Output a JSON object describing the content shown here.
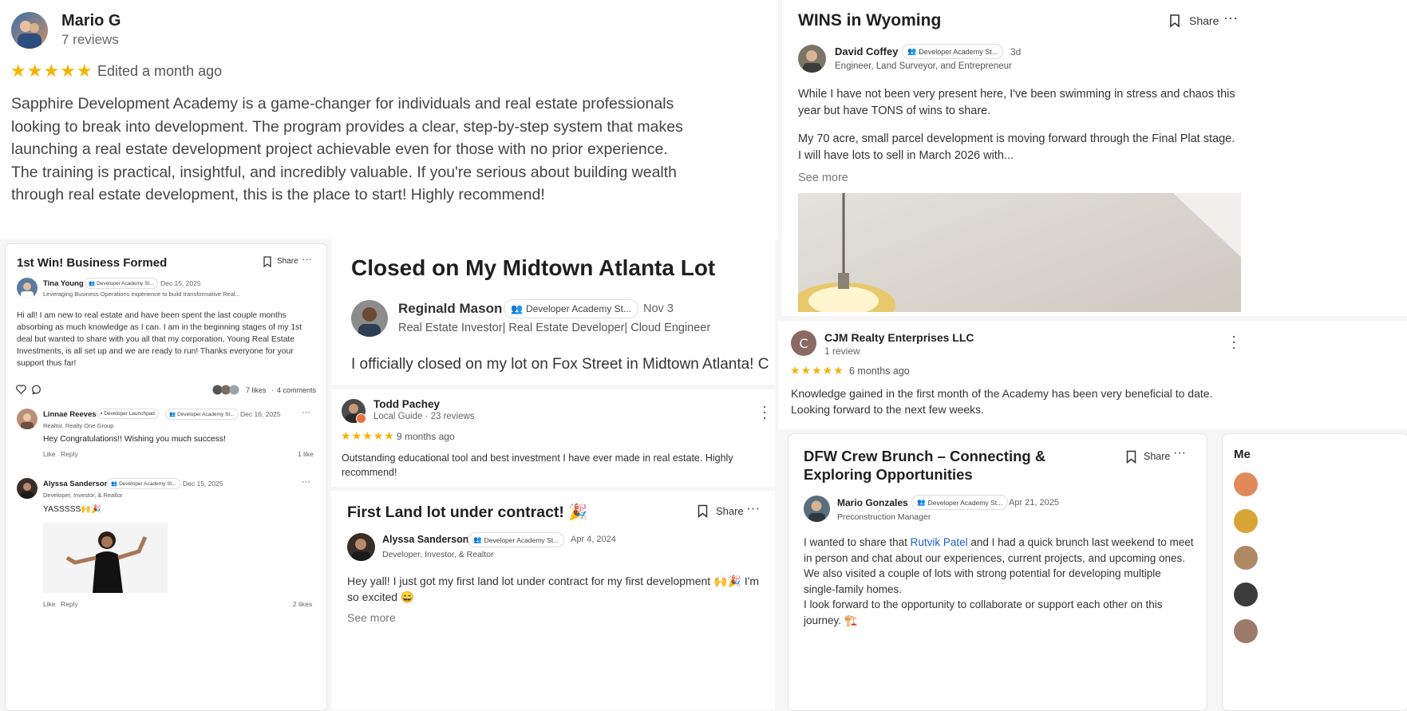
{
  "review_mario": {
    "name": "Mario G",
    "reviews": "7 reviews",
    "stars": "★★★★★",
    "edited": "Edited a month ago",
    "text": "Sapphire Development Academy is a game-changer for individuals and real estate professionals looking to break into development. The program provides a clear, step-by-step system that makes launching a real estate development project achievable even for those with no prior experience. The training is practical, insightful, and incredibly valuable. If you're serious about building wealth through real estate development, this is the place to start! Highly recommend!"
  },
  "post_wyoming": {
    "title": "WINS in Wyoming",
    "share": "Share",
    "author": "David Coffey",
    "badge": "Developer Academy St...",
    "time": "3d",
    "headline": "Engineer, Land Surveyor, and Entrepreneur",
    "para1": "While I have not been very present here, I've been swimming in stress and chaos this year but have TONS of wins to share.",
    "para2": "My 70 acre, small parcel development is moving forward through the Final Plat stage. I will have lots to sell in March 2026 with...",
    "see_more": "See more"
  },
  "review_cjm": {
    "initial": "C",
    "name": "CJM Realty Enterprises LLC",
    "reviews": "1 review",
    "stars": "★★★★★",
    "time": "6 months ago",
    "text": "Knowledge gained in the first month of the Academy has been very beneficial to date. Looking forward to the next few weeks."
  },
  "post_business": {
    "title": "1st Win! Business Formed",
    "share": "Share",
    "author": "Tina Young",
    "badge": "Developer Academy St...",
    "date": "Dec 15, 2025",
    "headline": "Leveraging Business Operations experience to build transformative Real...",
    "body": "Hi all! I am new to real estate and have been spent the last couple months absorbing as much knowledge as I can. I am in the beginning stages of my 1st deal but wanted to share with you all that my corporation, Young Real Estate Investments, is all set up and we are ready to run! Thanks everyone for your support thus far!",
    "likes": "7 likes",
    "comments": "4 comments",
    "comment1": {
      "name": "Linnae Reeves",
      "badge1": "Developer Launchpad",
      "badge2": "Developer Academy St...",
      "date": "Dec 16, 2025",
      "headline": "Realtor, Realty One Group",
      "text": "Hey Congratulations!! Wishing you much success!",
      "like": "Like",
      "reply": "Reply",
      "count": "1 like"
    },
    "comment2": {
      "name": "Alyssa Sanderson",
      "badge": "Developer Academy St...",
      "date": "Dec 15, 2025",
      "headline": "Developer, Investor, & Realtor",
      "text": "YASSSSS🙌🎉",
      "like": "Like",
      "reply": "Reply",
      "count": "2 likes"
    }
  },
  "post_midtown": {
    "title": "Closed on My Midtown Atlanta Lot",
    "author": "Reginald Mason",
    "badge": "Developer Academy St...",
    "date": "Nov 3",
    "headline": "Real Estate Investor| Real Estate Developer| Cloud Engineer",
    "body": "I officially closed on my lot on Fox Street in Midtown Atlanta! C"
  },
  "review_todd": {
    "name": "Todd Pachey",
    "meta": "Local Guide · 23 reviews",
    "stars": "★★★★★",
    "time": "9 months ago",
    "text": "Outstanding educational tool and best investment I have ever made in real estate. Highly recommend!"
  },
  "post_landlot": {
    "title": "First Land lot under contract! 🎉",
    "share": "Share",
    "author": "Alyssa Sanderson",
    "badge": "Developer Academy St...",
    "date": "Apr 4, 2024",
    "headline": "Developer, Investor, & Realtor",
    "body": "Hey yall! I just got my first land lot under contract for my first development 🙌🎉 I'm so excited 😄",
    "see_more": "See more"
  },
  "post_dfw": {
    "title_line1": "DFW Crew Brunch – Connecting &",
    "title_line2": "Exploring Opportunities",
    "share": "Share",
    "author": "Mario Gonzales",
    "badge": "Developer Academy St...",
    "date": "Apr 21, 2025",
    "headline": "Preconstruction Manager",
    "body_pre": "I wanted to share that ",
    "mention": "Rutvik Patel",
    "body_post": " and I had a quick brunch last weekend to meet in person and chat about our experiences, current projects, and upcoming ones. We also visited a couple of lots with strong potential for developing multiple single-family homes.",
    "body2": "I look forward to the opportunity to collaborate or support each other on this journey. 🏗️"
  },
  "side_panel": {
    "label": "Me"
  },
  "colors": {
    "star": "#f5b301",
    "link": "#1a5fd0",
    "cjm_avatar": "#8a6a62"
  }
}
